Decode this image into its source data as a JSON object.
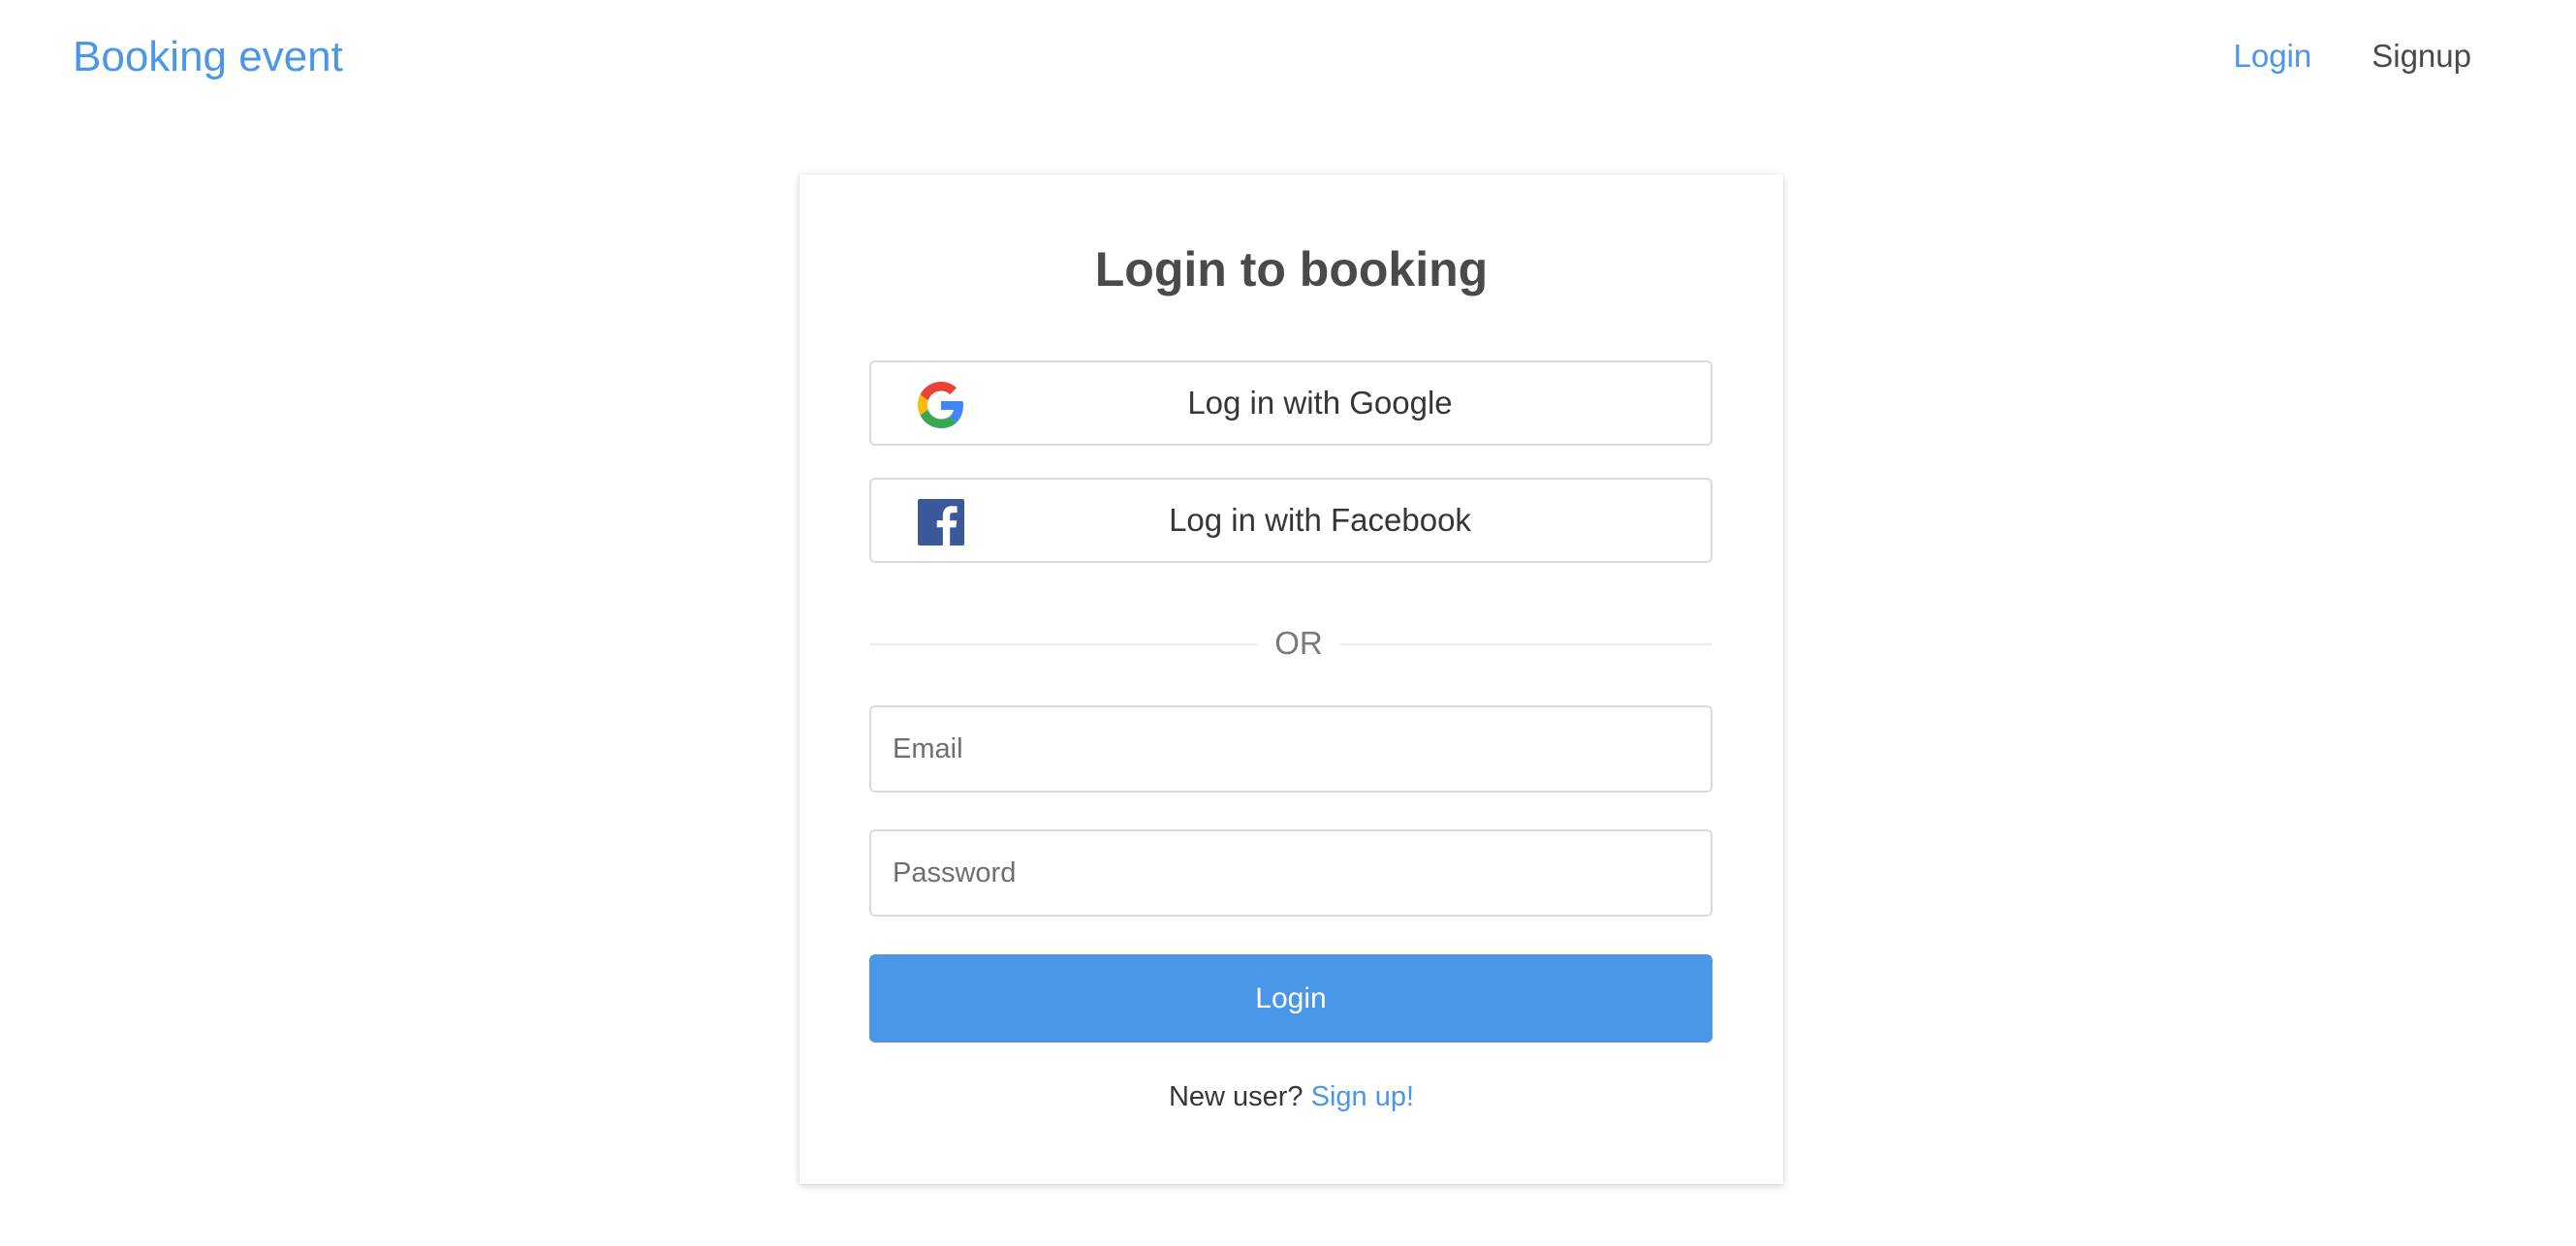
{
  "navbar": {
    "brand": "Booking event",
    "links": [
      {
        "label": "Login",
        "active": true
      },
      {
        "label": "Signup",
        "active": false
      }
    ]
  },
  "login_card": {
    "title": "Login to booking",
    "google_button_label": "Log in with Google",
    "facebook_button_label": "Log in with Facebook",
    "divider_label": "OR",
    "email_placeholder": "Email",
    "password_placeholder": "Password",
    "submit_label": "Login",
    "new_user_text": "New user?",
    "signup_link_label": "Sign up!"
  },
  "icons": {
    "google": "google-icon",
    "facebook": "facebook-icon"
  },
  "colors": {
    "accent": "#4a96e9",
    "text": "#4a4a4a",
    "border": "#dbdbdb",
    "facebook_blue": "#3b5998"
  }
}
